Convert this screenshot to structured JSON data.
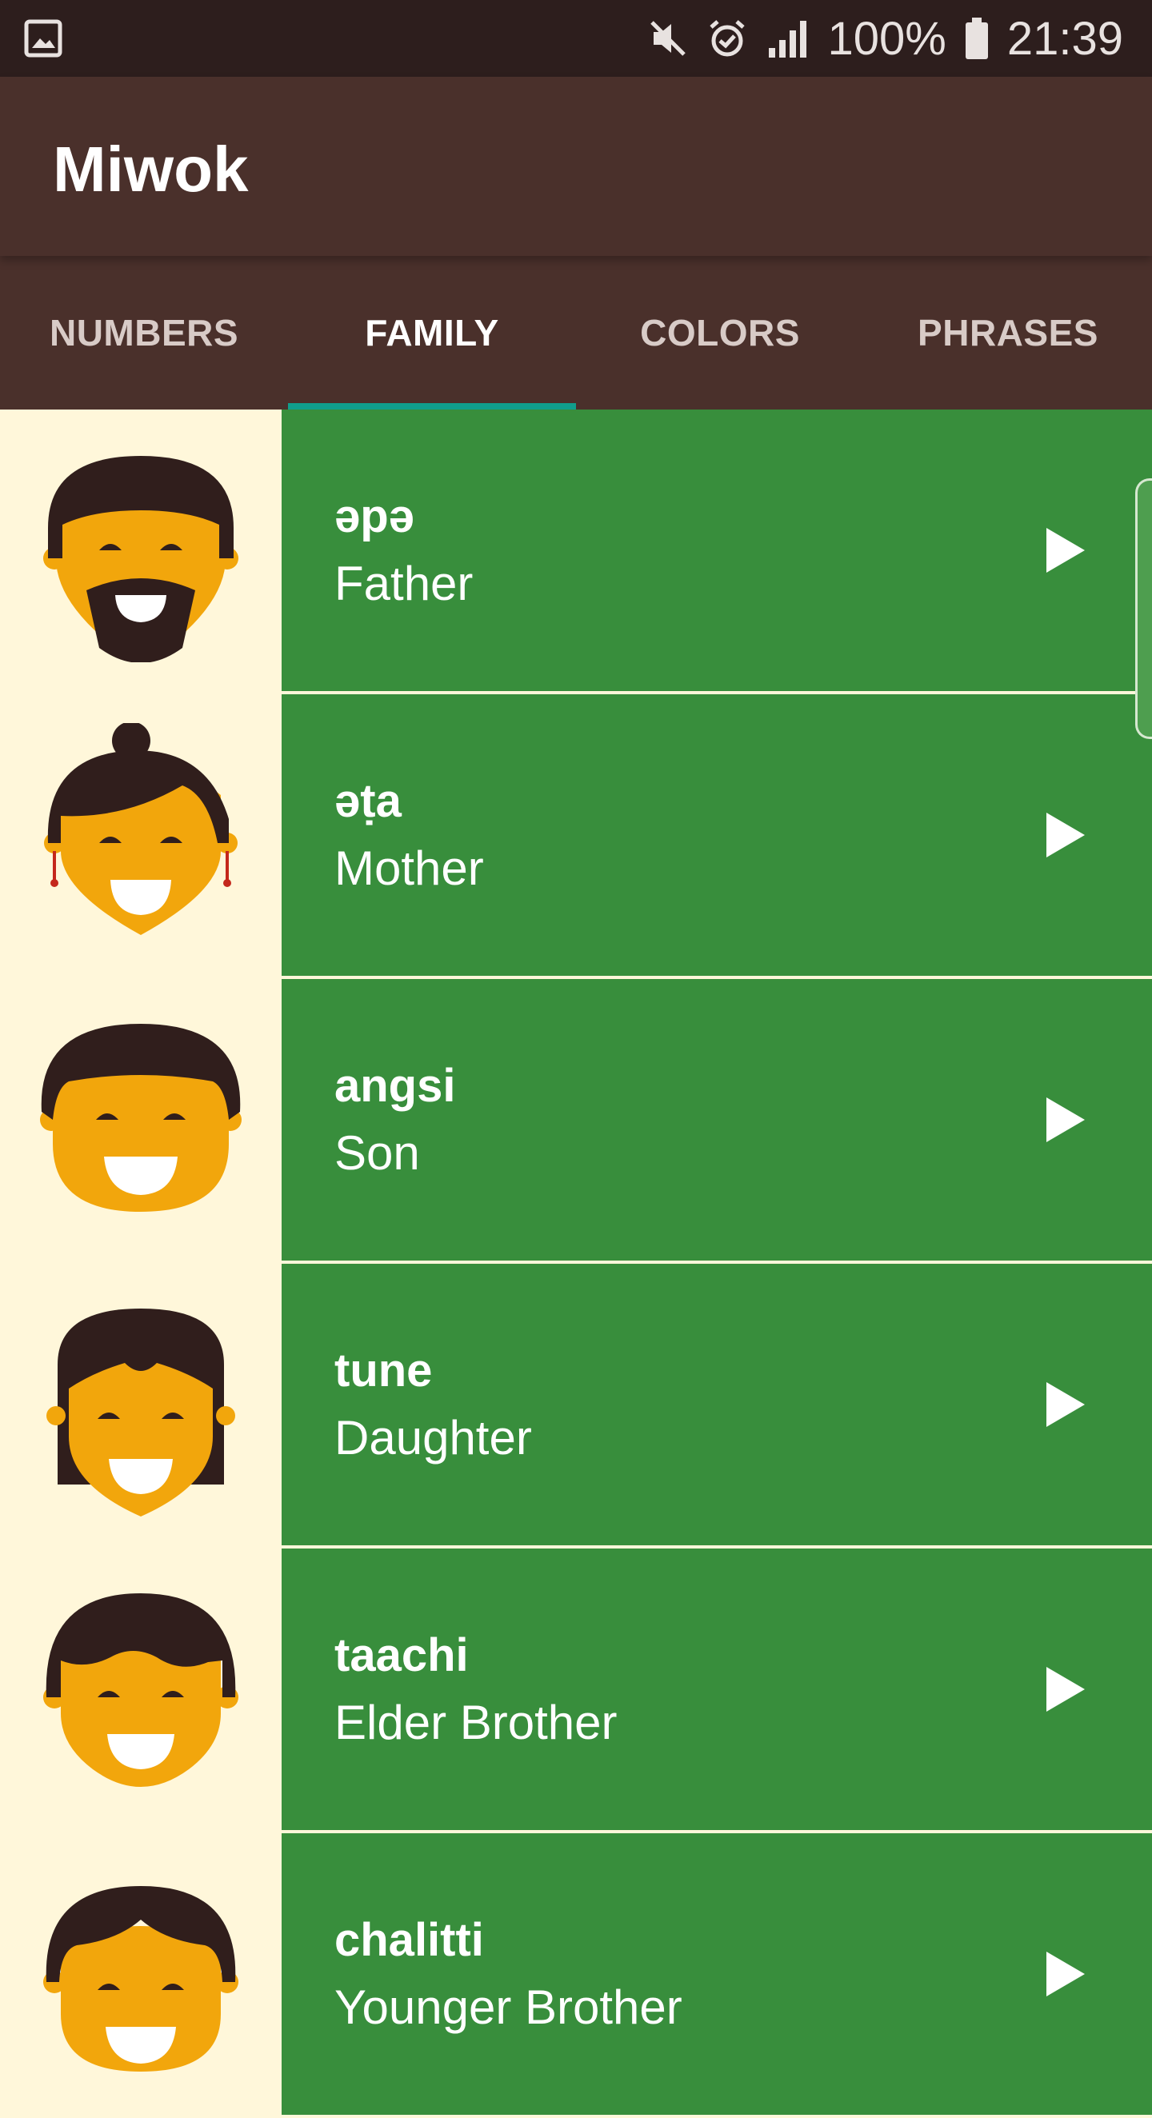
{
  "status_bar": {
    "battery": "100%",
    "time": "21:39",
    "icons": [
      "gallery-icon",
      "mute-icon",
      "alarm-icon",
      "signal-icon",
      "battery-icon"
    ]
  },
  "app_bar": {
    "title": "Miwok"
  },
  "tabs": [
    {
      "label": "NUMBERS",
      "active": false
    },
    {
      "label": "FAMILY",
      "active": true
    },
    {
      "label": "COLORS",
      "active": false
    },
    {
      "label": "PHRASES",
      "active": false
    }
  ],
  "colors": {
    "status_bar": "#2D1E1D",
    "primary": "#4A302B",
    "tab_indicator": "#109E8C",
    "list_background": "#388E3C",
    "image_background": "#FFF7DA",
    "skin": "#F2A60C",
    "hair": "#301E1C"
  },
  "words": [
    {
      "miwok": "әpә",
      "english": "Father",
      "icon": "father-icon"
    },
    {
      "miwok": "әṭa",
      "english": "Mother",
      "icon": "mother-icon"
    },
    {
      "miwok": "angsi",
      "english": "Son",
      "icon": "son-icon"
    },
    {
      "miwok": "tune",
      "english": "Daughter",
      "icon": "daughter-icon"
    },
    {
      "miwok": "taachi",
      "english": "Elder Brother",
      "icon": "elder-brother-icon"
    },
    {
      "miwok": "chalitti",
      "english": "Younger Brother",
      "icon": "younger-brother-icon"
    }
  ]
}
